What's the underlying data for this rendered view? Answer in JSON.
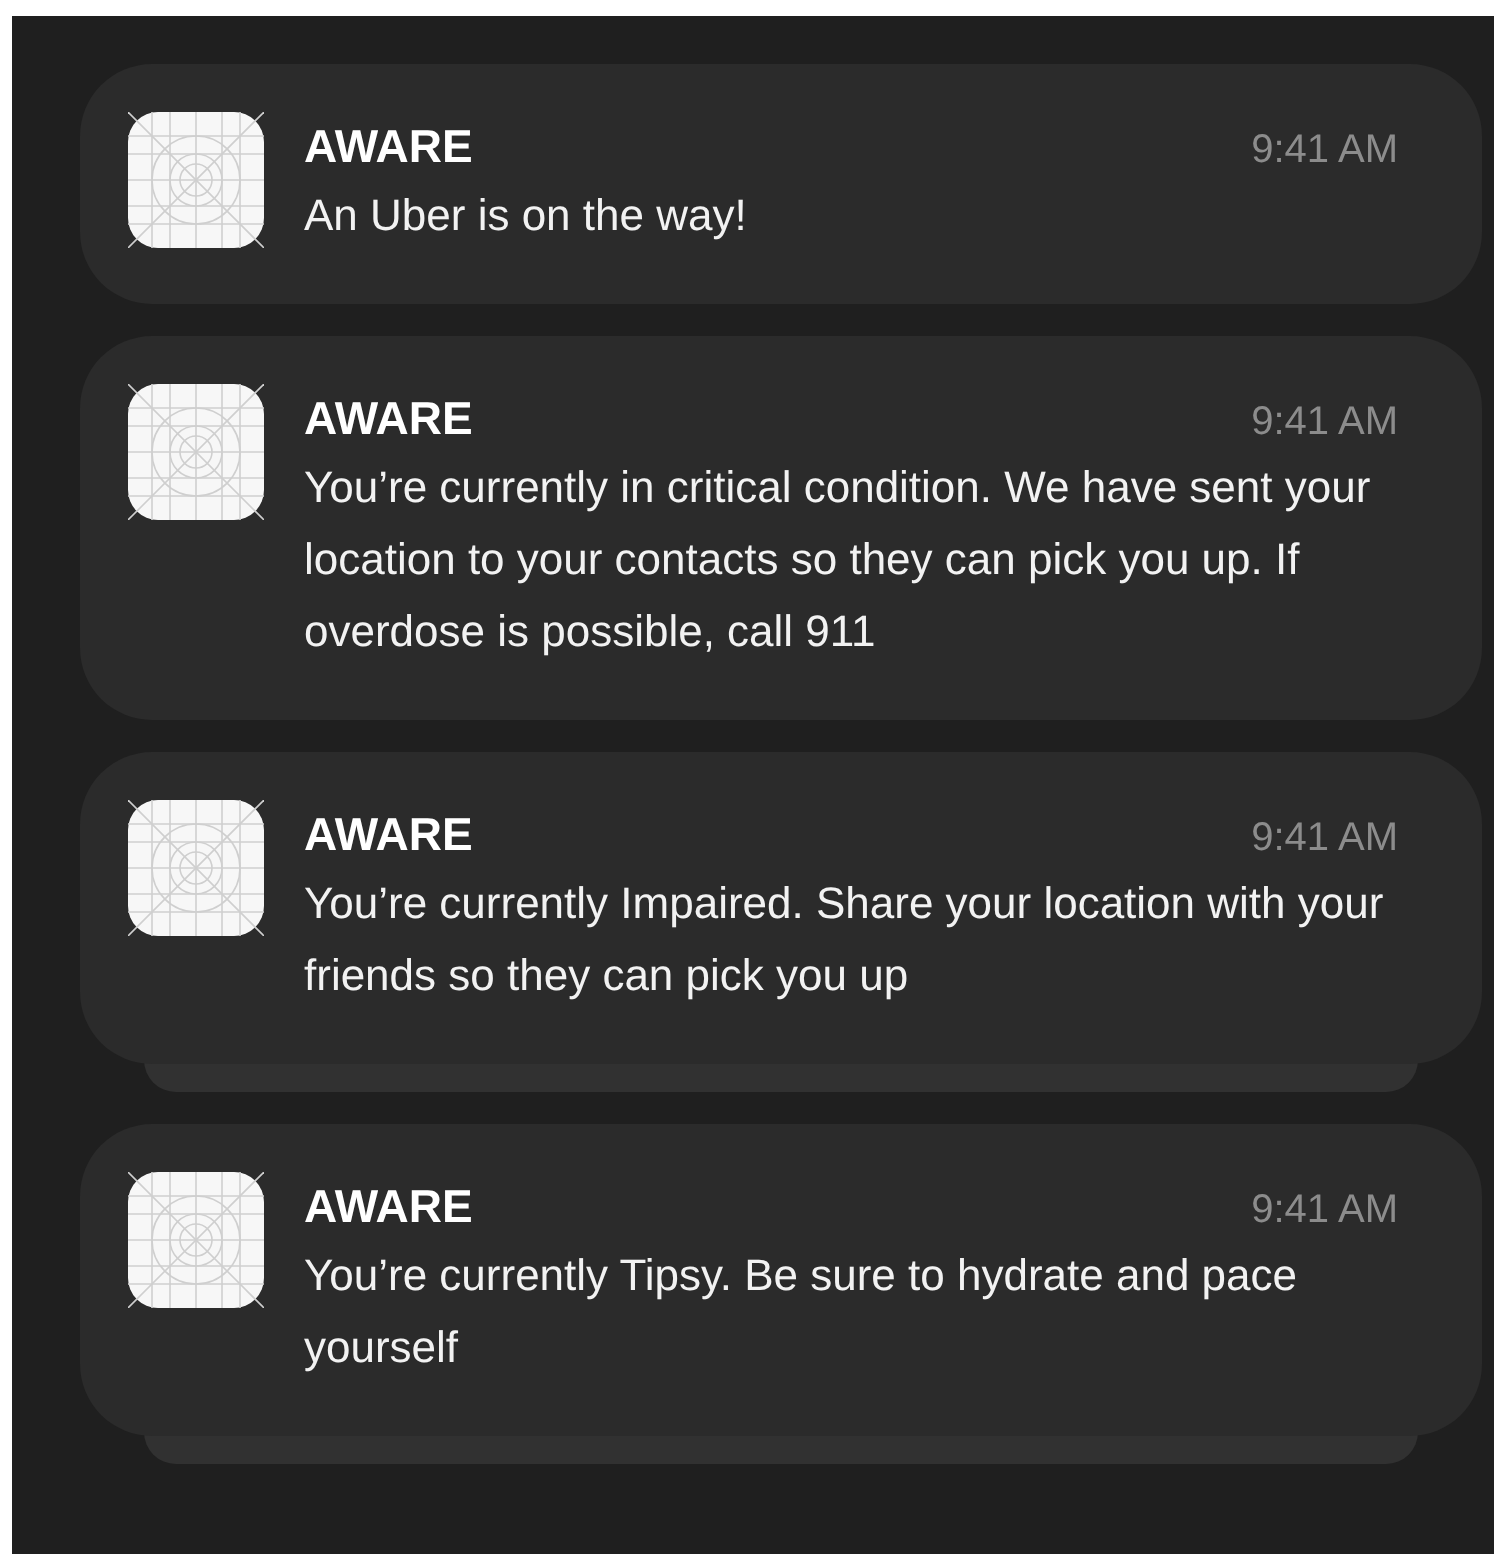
{
  "notifications": [
    {
      "app": "AWARE",
      "time": "9:41 AM",
      "message": "An Uber is on the way!",
      "stacked": false
    },
    {
      "app": "AWARE",
      "time": "9:41 AM",
      "message": "You’re currently in critical condition. We have sent your location to your contacts so they can pick you up. If overdose is possible, call 911",
      "stacked": false
    },
    {
      "app": "AWARE",
      "time": "9:41 AM",
      "message": "You’re currently Impaired. Share your location with your friends so they can pick you up",
      "stacked": true
    },
    {
      "app": "AWARE",
      "time": "9:41 AM",
      "message": "You’re currently Tipsy. Be sure to hydrate and pace yourself",
      "stacked": true
    }
  ]
}
